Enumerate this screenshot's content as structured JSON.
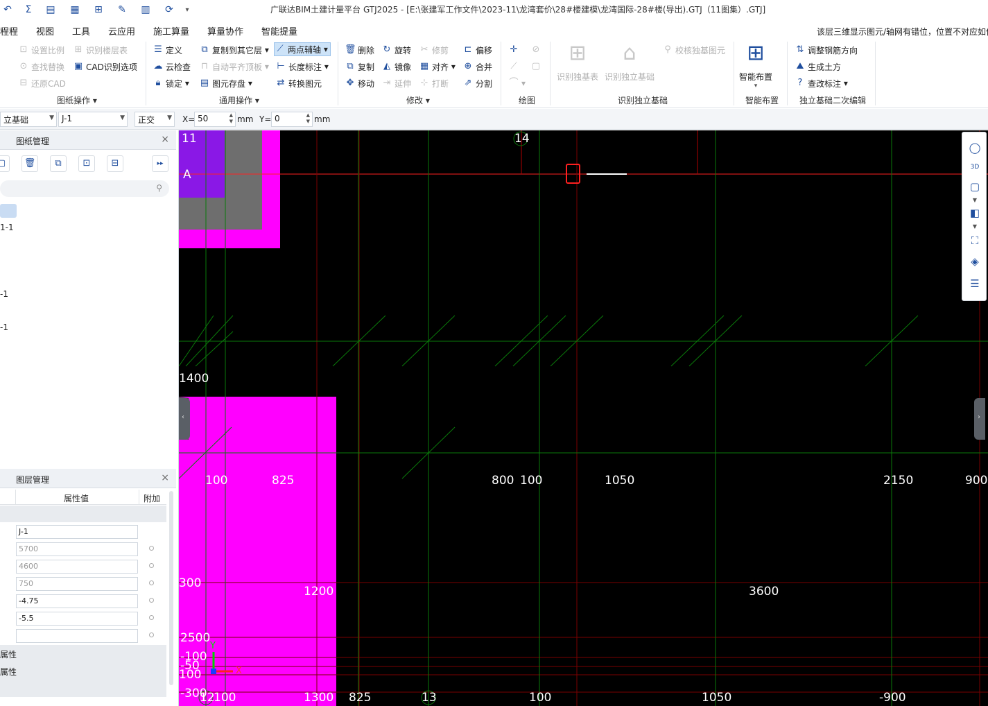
{
  "window": {
    "title": "广联达BIM土建计量平台 GTJ2025 - [E:\\张建军工作文件\\2023-11\\龙湾套价\\28#楼建模\\龙湾国际-28#楼(导出).GTJ（11图集）.GTJ]",
    "quick_access_icons": [
      "undo-icon",
      "sum-icon",
      "report-icon",
      "grid-icon",
      "tree-icon",
      "pen-icon",
      "ruler-icon",
      "sync-icon",
      "more-icon"
    ]
  },
  "menu": {
    "items": [
      "程程",
      "视图",
      "工具",
      "云应用",
      "施工算量",
      "算量协作",
      "智能提量"
    ],
    "notice": "该层三维显示图元/轴网有错位，位置不对应如何"
  },
  "ribbon": {
    "drawing_ops": {
      "label": "图纸操作",
      "set_scale": "设置比例",
      "find_replace": "查找替换",
      "restore_cad": "还原CAD",
      "identify_floor": "识别楼层表",
      "cad_options": "CAD识别选项"
    },
    "general_ops": {
      "label": "通用操作",
      "define": "定义",
      "cloud_check": "云检查",
      "lock": "锁定",
      "copy_to_floor": "复制到其它层",
      "auto_flat": "自动平齐顶板",
      "element_save": "图元存盘",
      "two_point_axis": "两点辅轴",
      "length_mark": "长度标注",
      "convert_element": "转换图元"
    },
    "modify": {
      "label": "修改",
      "delete": "删除",
      "copy": "复制",
      "move": "移动",
      "rotate": "旋转",
      "mirror": "镜像",
      "extend": "延伸",
      "trim": "修剪",
      "align": "对齐",
      "break": "打断",
      "offset": "偏移",
      "merge": "合并",
      "split": "分割"
    },
    "draw": {
      "label": "绘图"
    },
    "identify": {
      "label": "识别独立基础",
      "identify_table": "识别独基表",
      "identify_found": "识别独立基础",
      "verify": "校核独基图元"
    },
    "smart": {
      "label": "智能布置",
      "button": "智能布置"
    },
    "secondary": {
      "label": "独立基础二次编辑",
      "adjust_rebar": "调整钢筋方向",
      "gen_earth": "生成土方",
      "change_mark": "查改标注"
    }
  },
  "propbar": {
    "type_select": "立基础",
    "element_select": "J-1",
    "mode_select": "正交",
    "x_label": "X=",
    "x_value": "50",
    "x_unit": "mm",
    "y_label": "Y=",
    "y_value": "0",
    "y_unit": "mm"
  },
  "left_panel": {
    "drawing_mgmt_title": "图纸管理",
    "tree_items": [
      "1-1",
      "-1",
      "-1"
    ],
    "layer_mgmt_title": "图层管理",
    "col_value": "属性值",
    "col_extra": "附加",
    "values": [
      "J-1",
      "5700",
      "4600",
      "750",
      "-4.75",
      "-5.5",
      ""
    ],
    "sections": [
      "属性",
      "属性"
    ]
  },
  "canvas": {
    "axis_labels": [
      "11",
      "A",
      "14",
      "12",
      "13"
    ],
    "dimensions": [
      "1400",
      "100",
      "825",
      "800",
      "100",
      "1050",
      "2150",
      "900",
      "300",
      "1200",
      "3600",
      "2500",
      "-100",
      "-50",
      "100",
      "-300",
      "100",
      "1300",
      "825",
      "100",
      "1050",
      "-900"
    ],
    "axis_indicator": {
      "x": "X",
      "y": "Y"
    }
  }
}
